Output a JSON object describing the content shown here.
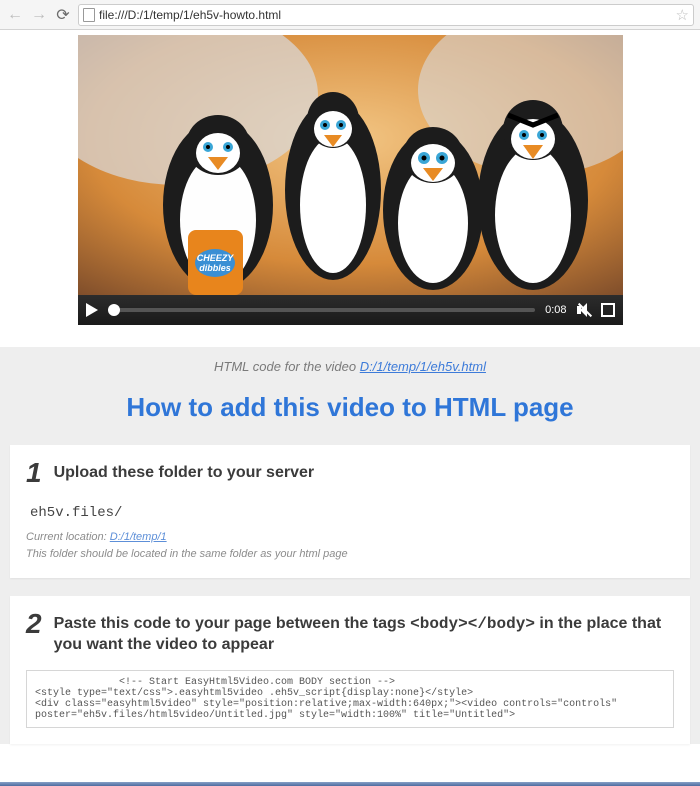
{
  "browser": {
    "url": "file:///D:/1/temp/1/eh5v-howto.html"
  },
  "video": {
    "time": "0:08"
  },
  "caption": {
    "prefix": "HTML code for the video ",
    "link": "D:/1/temp/1/eh5v.html"
  },
  "headline": "How to add this video to HTML page",
  "step1": {
    "num": "1",
    "title": "Upload these folder to your server",
    "folder": "eh5v.files/",
    "loc_prefix": "Current location: ",
    "loc_link": "D:/1/temp/1",
    "note": "This folder should be located in the same folder as your html page"
  },
  "step2": {
    "num": "2",
    "title_a": "Paste this code to your page between the tags ",
    "title_tags": "<body></body>",
    "title_b": " in the place that you want the video to appear",
    "code": "              <!-- Start EasyHtml5Video.com BODY section -->\n<style type=\"text/css\">.easyhtml5video .eh5v_script{display:none}</style>\n<div class=\"easyhtml5video\" style=\"position:relative;max-width:640px;\"><video controls=\"controls\"\nposter=\"eh5v.files/html5video/Untitled.jpg\" style=\"width:100%\" title=\"Untitled\">"
  }
}
